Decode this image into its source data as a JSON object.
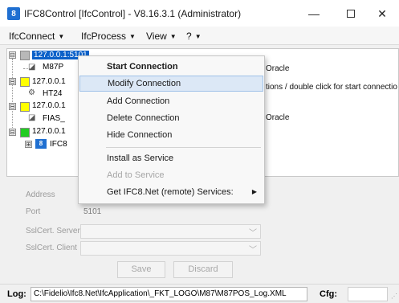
{
  "window": {
    "title": "IFC8Control [IfcControl] - V8.16.3.1 (Administrator)",
    "app_icon_text": "8",
    "minimize_glyph": "—",
    "close_glyph": "✕"
  },
  "menubar": {
    "items": [
      {
        "label": "IfcConnect"
      },
      {
        "label": "IfcProcess"
      },
      {
        "label": "View"
      },
      {
        "label": "?"
      }
    ],
    "caret": "▼"
  },
  "tree": {
    "nodes": [
      {
        "expander": "⊟",
        "status": "gray",
        "label": "127.0.0.1:5101",
        "selected": true
      },
      {
        "child_label": "M87P",
        "right_text": "Oracle"
      },
      {
        "expander": "⊟",
        "status": "yellow",
        "label": "127.0.0.1",
        "right_text": "tions / double click for start connectio"
      },
      {
        "child_label": "HT24"
      },
      {
        "expander": "⊟",
        "status": "yellow",
        "label": "127.0.0.1"
      },
      {
        "child_label": "FIAS_",
        "right_text": "Oracle"
      },
      {
        "expander": "⊟",
        "status": "green",
        "label": "127.0.0.1"
      },
      {
        "child_label": "IFC8",
        "child_icon": "8",
        "child_expander": "⊞"
      }
    ]
  },
  "form": {
    "address_label": "Address",
    "port_label": "Port",
    "port_value": "5101",
    "sslcert_server_label": "SslCert. Server",
    "sslcert_client_label": "SslCert. Client",
    "combo_arrow": "﹀",
    "save_label": "Save",
    "discard_label": "Discard"
  },
  "status": {
    "log_label": "Log:",
    "log_path": "C:\\Fidelio\\Ifc8.Net\\IfcApplication\\_FKT_LOGO\\M87\\M87POS_Log.XML",
    "cfg_label": "Cfg:"
  },
  "context_menu": {
    "items": [
      {
        "label": "Start Connection",
        "bold": true
      },
      {
        "label": "Modify Connection",
        "hover": true
      },
      {
        "label": "Add Connection"
      },
      {
        "label": "Delete Connection"
      },
      {
        "label": "Hide Connection"
      },
      {
        "label": "Install as Service"
      },
      {
        "label": "Add to Service",
        "disabled": true
      },
      {
        "label": "Get IFC8.Net (remote) Services:",
        "submenu_arrow": "▶"
      }
    ]
  },
  "colors": {
    "selection": "#0b61c9",
    "menu_hover": "#dce8f6",
    "status_yellow": "#ffff00",
    "status_green": "#22cc22",
    "status_gray": "#b8b8b8"
  }
}
